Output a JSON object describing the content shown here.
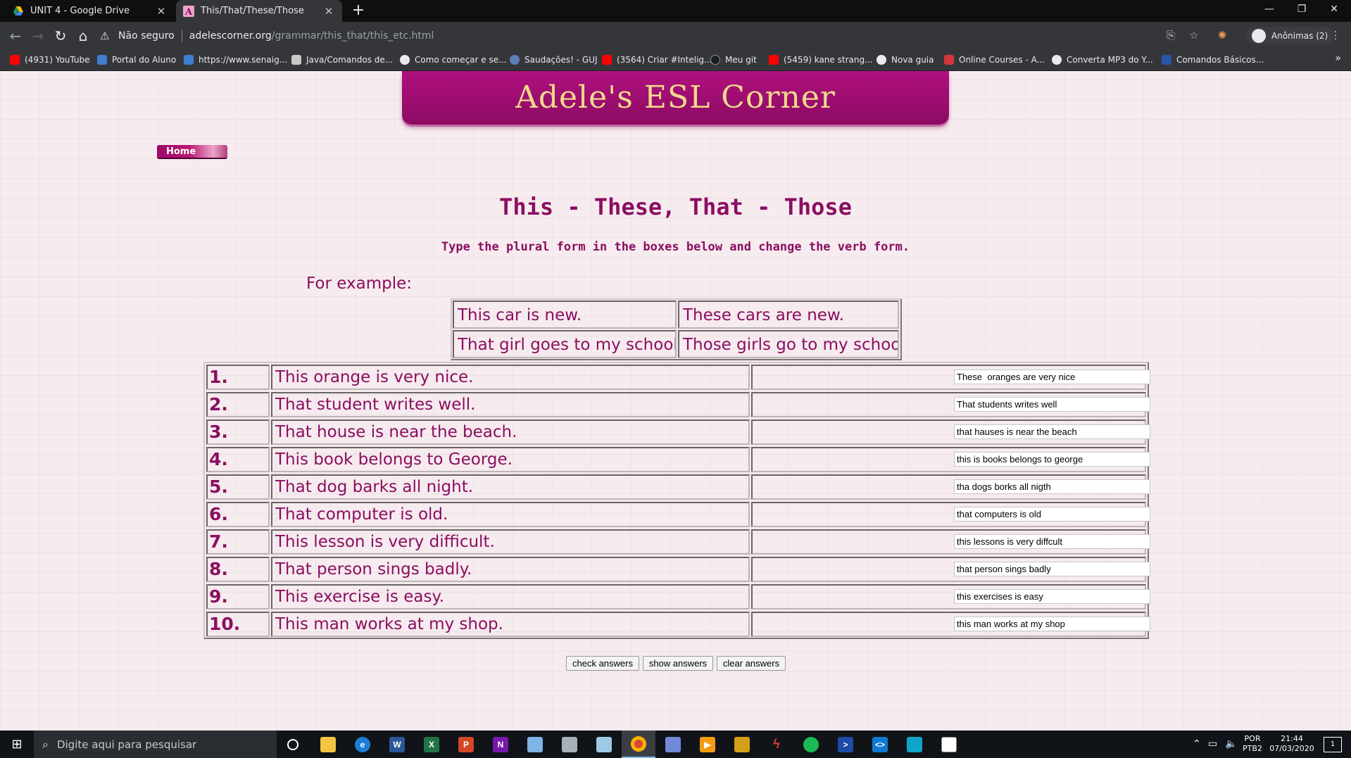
{
  "browser": {
    "tabs": [
      {
        "title": "UNIT 4 - Google Drive",
        "active": false
      },
      {
        "title": "This/That/These/Those",
        "active": true
      }
    ],
    "new_tab_glyph": "+",
    "security_label": "Não seguro",
    "url_host": "adelescorner.org",
    "url_path": "/grammar/this_that/this_etc.html",
    "profile_label": "Anônimas (2)",
    "bookmarks": [
      {
        "label": "(4931) YouTube",
        "icon_color": "#ff0000"
      },
      {
        "label": "Portal do Aluno",
        "icon_color": "#3f7fd0"
      },
      {
        "label": "https://www.senaig...",
        "icon_color": "#3f7fd0"
      },
      {
        "label": "Java/Comandos de...",
        "icon_color": "#c8c8c8"
      },
      {
        "label": "Como começar e se...",
        "icon_color": "#e8eaed"
      },
      {
        "label": "Saudações! - GUJ",
        "icon_color": "#5b7fb5"
      },
      {
        "label": "(3564) Criar #Intelig...",
        "icon_color": "#ff0000"
      },
      {
        "label": "Meu git",
        "icon_color": "#1b1f23"
      },
      {
        "label": "(5459) kane strang...",
        "icon_color": "#ff0000"
      },
      {
        "label": "Nova guia",
        "icon_color": "#e8eaed"
      },
      {
        "label": "Online Courses - A...",
        "icon_color": "#d1373d"
      },
      {
        "label": "Converta MP3 do Y...",
        "icon_color": "#e8eaed"
      },
      {
        "label": "Comandos Básicos...",
        "icon_color": "#2a56a8"
      }
    ],
    "bookmarks_more": "»"
  },
  "page": {
    "banner_title": "Adele's ESL Corner",
    "home_label": "Home",
    "title": "This - These, That - Those",
    "subtitle": "Type the plural form in the boxes below and change the verb form.",
    "example_label": "For example:",
    "examples": [
      {
        "singular": "This car is new.",
        "plural": "These cars are new."
      },
      {
        "singular": "That girl goes to my school.",
        "plural": "Those girls go to my school."
      }
    ],
    "questions": [
      {
        "num": "1.",
        "sentence": "This orange is very nice.",
        "answer": "These  oranges are very nice"
      },
      {
        "num": "2.",
        "sentence": "That student writes well.",
        "answer": "That students writes well"
      },
      {
        "num": "3.",
        "sentence": "That house is near the beach.",
        "answer": "that hauses is near the beach"
      },
      {
        "num": "4.",
        "sentence": "This book belongs to George.",
        "answer": "this is books belongs to george"
      },
      {
        "num": "5.",
        "sentence": "That dog barks all night.",
        "answer": "tha dogs borks all nigth"
      },
      {
        "num": "6.",
        "sentence": "That computer is old.",
        "answer": "that computers is old"
      },
      {
        "num": "7.",
        "sentence": "This lesson is very difficult.",
        "answer": "this lessons is very diffcult"
      },
      {
        "num": "8.",
        "sentence": "That person sings badly.",
        "answer": "that person sings badly"
      },
      {
        "num": "9.",
        "sentence": "This exercise is easy.",
        "answer": "this exercises is easy"
      },
      {
        "num": "10.",
        "sentence": "This man works at my shop.",
        "answer": "this man works at my shop"
      }
    ],
    "buttons": {
      "check": "check answers",
      "show": "show answers",
      "clear": "clear answers"
    },
    "colors": {
      "accent": "#8b0e62",
      "banner": "#a00d73",
      "banner_text": "#f1d98c",
      "background": "#f6ebee"
    }
  },
  "taskbar": {
    "search_placeholder": "Digite aqui para pesquisar",
    "apps": [
      "cortana",
      "file-explorer",
      "edge",
      "word",
      "excel",
      "powerpoint",
      "onenote",
      "3d-viewer",
      "photos-app",
      "sticky-app",
      "chrome",
      "discord",
      "media-player",
      "library-app",
      "bolt-app",
      "spotify",
      "powershell",
      "vscode",
      "camera-app",
      "photos"
    ],
    "language": "POR",
    "keyboard": "PTB2",
    "time": "21:44",
    "date": "07/03/2020",
    "notification_count": "1"
  }
}
